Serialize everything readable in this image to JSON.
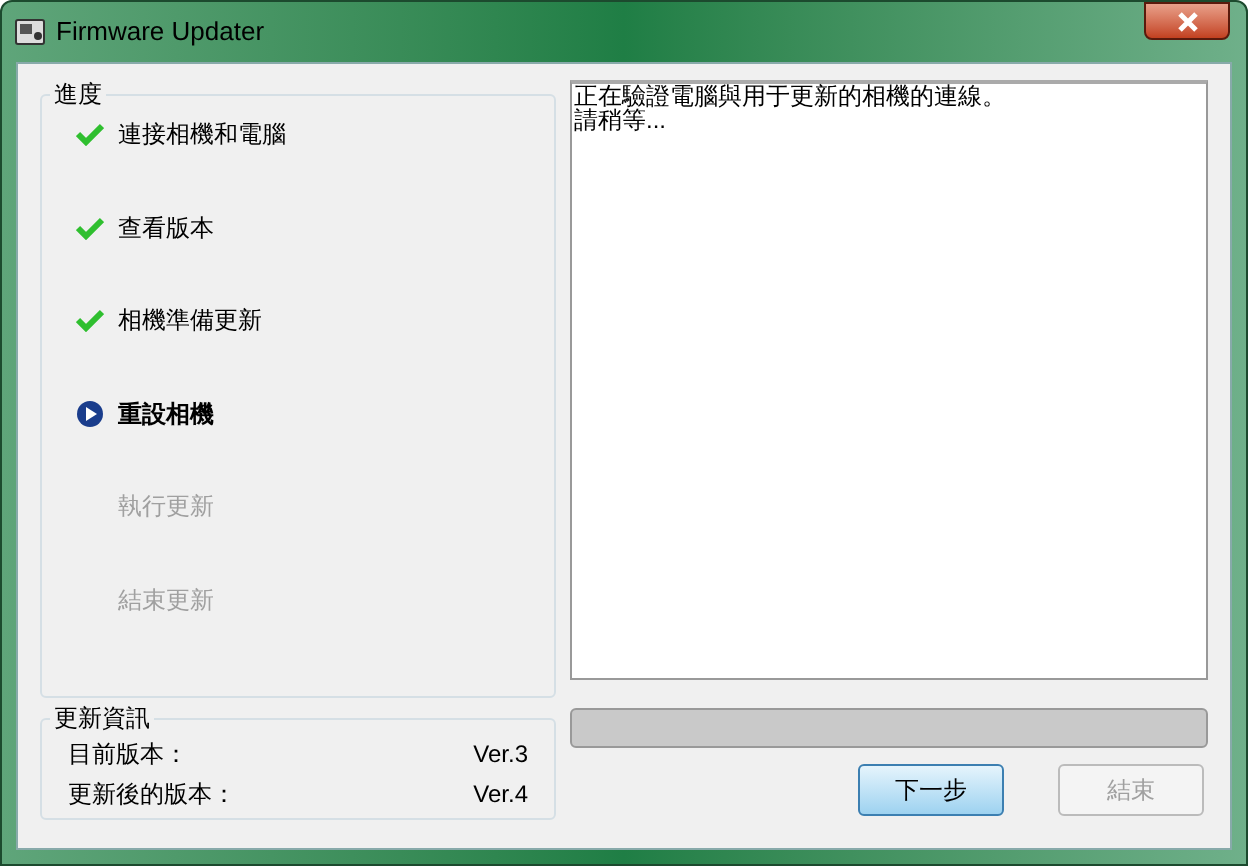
{
  "window": {
    "title": "Firmware Updater"
  },
  "progress_group": {
    "title": "進度",
    "steps": [
      {
        "label": "連接相機和電腦",
        "kind": "done"
      },
      {
        "label": "查看版本",
        "kind": "done"
      },
      {
        "label": "相機準備更新",
        "kind": "done"
      },
      {
        "label": "重設相機",
        "kind": "current"
      },
      {
        "label": "執行更新",
        "kind": "pending"
      },
      {
        "label": "結束更新",
        "kind": "pending"
      }
    ]
  },
  "info_group": {
    "title": "更新資訊",
    "rows": [
      {
        "label": "目前版本：",
        "value": "Ver.3"
      },
      {
        "label": "更新後的版本：",
        "value": "Ver.4"
      }
    ]
  },
  "message_lines": [
    "正在驗證電腦與用于更新的相機的連線。",
    "請稍等..."
  ],
  "progress": {
    "level": 0
  },
  "buttons": [
    {
      "label": "下一步",
      "disabled": false
    },
    {
      "label": "結束",
      "disabled": true
    }
  ]
}
